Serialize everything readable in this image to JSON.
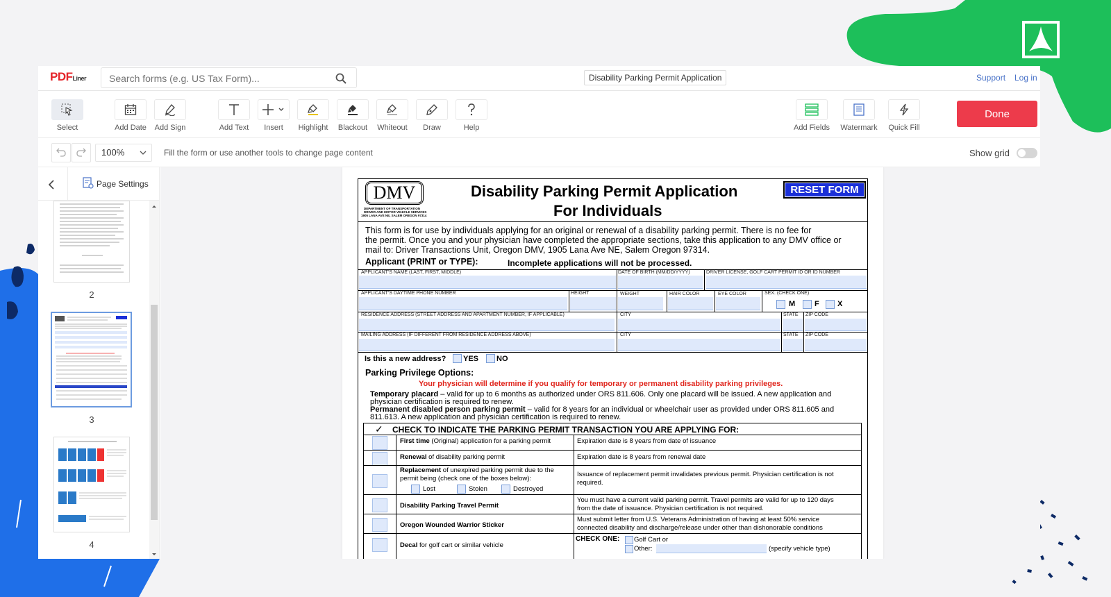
{
  "app": {
    "logo_main": "PDF",
    "logo_sub": "Liner",
    "search_placeholder": "Search forms (e.g. US Tax Form)...",
    "document_title": "Disability Parking Permit Application",
    "support_link": "Support",
    "login_link": "Log in"
  },
  "toolbar": {
    "tools": {
      "select": "Select",
      "add_date": "Add Date",
      "add_sign": "Add Sign",
      "add_text": "Add Text",
      "insert": "Insert",
      "highlight": "Highlight",
      "blackout": "Blackout",
      "whiteout": "Whiteout",
      "draw": "Draw",
      "help": "Help",
      "add_fields": "Add Fields",
      "watermark": "Watermark",
      "quick_fill": "Quick Fill"
    },
    "done_label": "Done"
  },
  "subbar": {
    "zoom": "100%",
    "hint": "Fill the form or use another tools to change page content",
    "show_grid": "Show grid"
  },
  "sidebar": {
    "page_settings": "Page Settings",
    "pages": [
      "2",
      "3",
      "4"
    ]
  },
  "colors": {
    "accent_red": "#ED3B4B",
    "link_blue": "#4A73C8",
    "field_blue": "#DFE9FB",
    "deco_green": "#1DBF5A",
    "deco_blue": "#1F6FE8"
  },
  "form": {
    "dmv_logo": "DMV",
    "dmv_address_1": "DEPARTMENT OF TRANSPORTATION",
    "dmv_address_2": "DRIVER AND MOTOR VEHICLE SERVICES",
    "dmv_address_3": "1905 LANA AVE NE, SALEM OREGON 97314",
    "title_1": "Disability Parking Permit Application",
    "title_2": "For Individuals",
    "reset": "RESET FORM",
    "intro_1": "This form is for use by individuals applying for an original or renewal of a disability parking permit. There is no fee for",
    "intro_2": "the permit. Once you and your physician have completed the appropriate sections, take this application to any DMV office or",
    "intro_3": "mail to: Driver Transactions Unit, Oregon DMV, 1905 Lana Ave NE, Salem Oregon 97314.",
    "applicant_heading": "Applicant (PRINT or TYPE):",
    "incomplete": "Incomplete applications will not be processed.",
    "labels": {
      "name": "APPLICANT'S NAME (LAST, FIRST, MIDDLE)",
      "dob": "DATE OF BIRTH (MM/DD/YYYY)",
      "license": "DRIVER LICENSE, GOLF CART PERMIT ID OR ID NUMBER",
      "phone": "APPLICANT'S DAYTIME PHONE NUMBER",
      "height": "HEIGHT",
      "weight": "WEIGHT",
      "hair": "HAIR COLOR",
      "eye": "EYE COLOR",
      "sex": "SEX: (CHECK ONE)",
      "sex_m": "M",
      "sex_f": "F",
      "sex_x": "X",
      "residence": "RESIDENCE ADDRESS (STREET ADDRESS AND APARTMENT NUMBER, IF APPLICABLE)",
      "city": "CITY",
      "state": "STATE",
      "zip": "ZIP CODE",
      "mailing": "MAILING ADDRESS (IF DIFFERENT FROM RESIDENCE ADDRESS ABOVE)"
    },
    "new_address_q": "Is this a new address?",
    "yes": "YES",
    "no": "NO",
    "options_heading": "Parking Privilege Options:",
    "physician_note": "Your physician will determine if you qualify for temporary or permanent disability parking privileges.",
    "temp_bold": "Temporary placard",
    "temp_text_1": " – valid for up to 6 months as authorized under ORS 811.606. Only one placard will be issued. A new application and",
    "temp_text_2": "physician certification is required to renew.",
    "perm_bold": "Permanent disabled person parking permit",
    "perm_text_1": " – valid for 8 years for an individual or wheelchair user as provided under ORS 811.605 and",
    "perm_text_2": "811.613. A new application and physician certification is required to renew.",
    "check_mark": "✓",
    "check_heading": "CHECK TO INDICATE THE PARKING PERMIT TRANSACTION YOU ARE APPLYING FOR:",
    "rows": [
      {
        "bold": "First time",
        "text": " (Original) application for a parking permit",
        "desc": "Expiration date is 8 years from date of issuance"
      },
      {
        "bold": "Renewal",
        "text": " of disability parking permit",
        "desc": "Expiration date is 8 years from renewal date"
      },
      {
        "bold": "Replacement",
        "text": " of unexpired parking permit due to the",
        "text2": "permit being (check one of the boxes below):",
        "desc": "Issuance of replacement permit invalidates previous permit. Physician certification is not",
        "desc2": "required."
      },
      {
        "bold": "Disability Parking Travel Permit",
        "text": "",
        "desc": "You must have a current valid parking permit. Travel permits are valid for up to 120 days",
        "desc2": "from the date of issuance. Physician certification is not required."
      },
      {
        "bold": "Oregon Wounded Warrior Sticker",
        "text": "",
        "desc": "Must submit letter from U.S. Veterans Administration of having at least 50% service",
        "desc2": "connected disability and discharge/release under other than dishonorable conditions"
      },
      {
        "bold": "Decal",
        "text": " for golf cart or similar vehicle",
        "desc": ""
      }
    ],
    "lost": "Lost",
    "stolen": "Stolen",
    "destroyed": "Destroyed",
    "check_one": "CHECK ONE:",
    "golf_cart": "Golf Cart  or",
    "other": "Other:",
    "specify": "(specify vehicle type)"
  }
}
